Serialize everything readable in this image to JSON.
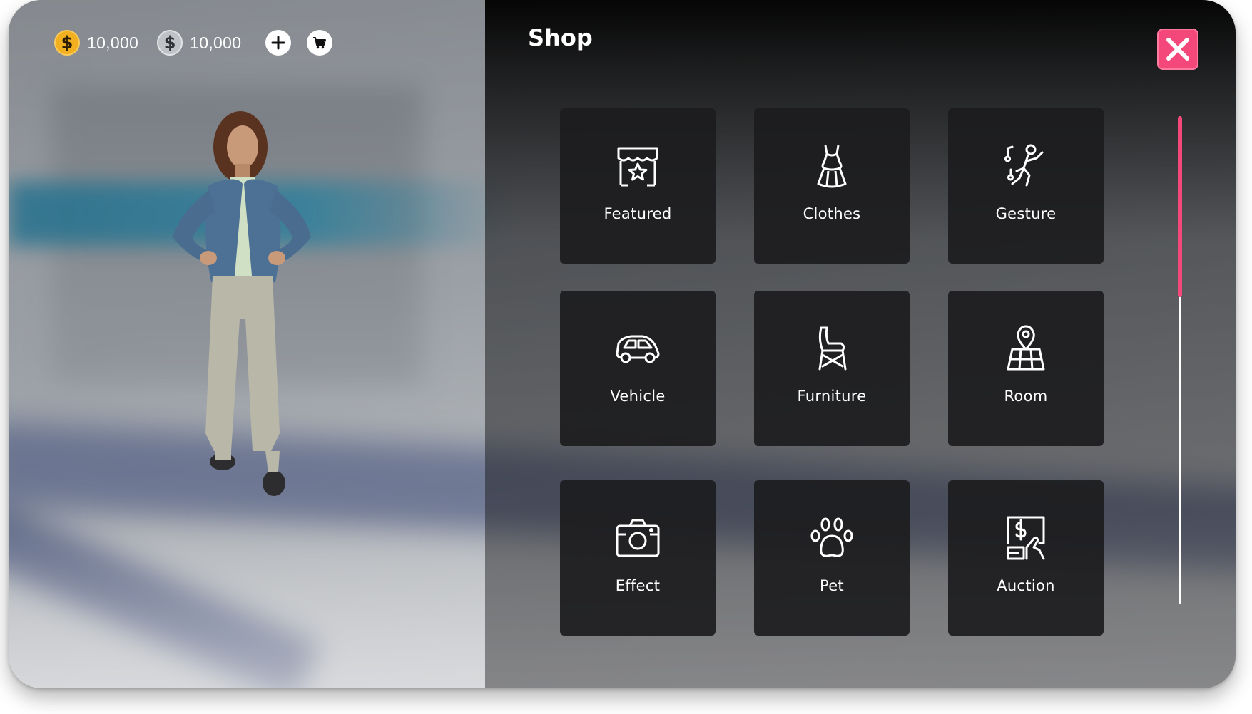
{
  "currency": {
    "gold": {
      "icon": "gold-coin-icon",
      "symbol": "$",
      "amount": "10,000"
    },
    "silver": {
      "icon": "silver-coin-icon",
      "symbol": "$",
      "amount": "10,000"
    },
    "add_icon": "plus-icon",
    "cart_icon": "cart-icon"
  },
  "shop": {
    "title": "Shop",
    "close_icon": "close-icon",
    "categories": [
      {
        "label": "Featured",
        "icon": "storefront-star-icon"
      },
      {
        "label": "Clothes",
        "icon": "dress-icon"
      },
      {
        "label": "Gesture",
        "icon": "dancing-person-icon"
      },
      {
        "label": "Vehicle",
        "icon": "car-icon"
      },
      {
        "label": "Furniture",
        "icon": "chair-icon"
      },
      {
        "label": "Room",
        "icon": "map-pin-icon"
      },
      {
        "label": "Effect",
        "icon": "camera-icon"
      },
      {
        "label": "Pet",
        "icon": "paw-icon"
      },
      {
        "label": "Auction",
        "icon": "auction-icon"
      }
    ],
    "scroll_position": 0.37
  },
  "colors": {
    "accent": "#f4487a",
    "gold": "#f2b021",
    "silver": "#bfc3c7"
  }
}
